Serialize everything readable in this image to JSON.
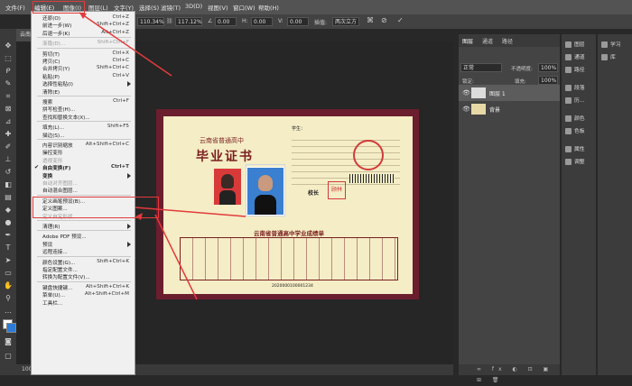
{
  "menubar": {
    "items": [
      "文件(F)",
      "编辑(E)",
      "图像(I)",
      "图层(L)",
      "文字(Y)",
      "选择(S)",
      "滤镜(T)",
      "3D(D)",
      "视图(V)",
      "窗口(W)",
      "帮助(H)"
    ]
  },
  "optionsbar": {
    "x_value": "110.34%",
    "y_value": "117.12%",
    "angle_value": "0.00",
    "h_value": "0.00",
    "v_value": "0.00",
    "interp": "两次立方",
    "angle_label": "∠",
    "h_label": "H:",
    "v_label": "V:",
    "interp_label": "插值:"
  },
  "doc_tab": "云南省",
  "status": "100%",
  "edit_menu": {
    "items": [
      {
        "label": "还原(O)",
        "shortcut": "Ctrl+Z",
        "disabled": false
      },
      {
        "label": "前进一步(W)",
        "shortcut": "Shift+Ctrl+Z",
        "disabled": false
      },
      {
        "label": "后退一步(K)",
        "shortcut": "Alt+Ctrl+Z",
        "disabled": false
      },
      {
        "sep": true
      },
      {
        "label": "渐隐(D)...",
        "shortcut": "Shift+Ctrl+F",
        "disabled": true
      },
      {
        "sep": true
      },
      {
        "label": "剪切(T)",
        "shortcut": "Ctrl+X",
        "disabled": false
      },
      {
        "label": "拷贝(C)",
        "shortcut": "Ctrl+C",
        "disabled": false
      },
      {
        "label": "合并拷贝(Y)",
        "shortcut": "Shift+Ctrl+C",
        "disabled": false
      },
      {
        "label": "粘贴(P)",
        "shortcut": "Ctrl+V",
        "disabled": false
      },
      {
        "label": "选择性粘贴(I)",
        "shortcut": "",
        "disabled": false,
        "submenu": true
      },
      {
        "label": "清除(E)",
        "shortcut": "",
        "disabled": false
      },
      {
        "sep": true
      },
      {
        "label": "搜索",
        "shortcut": "Ctrl+F",
        "disabled": false
      },
      {
        "label": "拼写检查(H)...",
        "shortcut": "",
        "disabled": false
      },
      {
        "label": "查找和替换文本(X)...",
        "shortcut": "",
        "disabled": false
      },
      {
        "sep": true
      },
      {
        "label": "填充(L)...",
        "shortcut": "Shift+F5",
        "disabled": false
      },
      {
        "label": "描边(S)...",
        "shortcut": "",
        "disabled": false
      },
      {
        "sep": true
      },
      {
        "label": "内容识别缩放",
        "shortcut": "Alt+Shift+Ctrl+C",
        "disabled": false
      },
      {
        "label": "操控变形",
        "shortcut": "",
        "disabled": false
      },
      {
        "label": "透视变形",
        "shortcut": "",
        "disabled": true
      },
      {
        "label": "自由变换(F)",
        "shortcut": "Ctrl+T",
        "disabled": false,
        "checked": true,
        "bold": true
      },
      {
        "label": "变换",
        "shortcut": "",
        "disabled": false,
        "submenu": true,
        "bold": true
      },
      {
        "label": "自动对齐图层...",
        "shortcut": "",
        "disabled": true
      },
      {
        "label": "自动混合图层...",
        "shortcut": "",
        "disabled": false
      },
      {
        "sep": true
      },
      {
        "label": "定义画笔预设(B)...",
        "shortcut": "",
        "disabled": false
      },
      {
        "label": "定义图案...",
        "shortcut": "",
        "disabled": false
      },
      {
        "label": "定义自定形状...",
        "shortcut": "",
        "disabled": true
      },
      {
        "sep": true
      },
      {
        "label": "清理(R)",
        "shortcut": "",
        "disabled": false,
        "submenu": true
      },
      {
        "sep": true
      },
      {
        "label": "Adobe PDF 预设...",
        "shortcut": "",
        "disabled": false
      },
      {
        "label": "预设",
        "shortcut": "",
        "disabled": false,
        "submenu": true
      },
      {
        "label": "远程连接...",
        "shortcut": "",
        "disabled": false
      },
      {
        "sep": true
      },
      {
        "label": "颜色设置(G)...",
        "shortcut": "Shift+Ctrl+K",
        "disabled": false
      },
      {
        "label": "指定配置文件...",
        "shortcut": "",
        "disabled": false
      },
      {
        "label": "转换为配置文件(V)...",
        "shortcut": "",
        "disabled": false
      },
      {
        "sep": true
      },
      {
        "label": "键盘快捷键...",
        "shortcut": "Alt+Shift+Ctrl+K",
        "disabled": false
      },
      {
        "label": "菜单(U)...",
        "shortcut": "Alt+Shift+Ctrl+M",
        "disabled": false
      },
      {
        "label": "工具栏...",
        "shortcut": "",
        "disabled": false
      }
    ]
  },
  "layers_panel": {
    "tabs": [
      "图层",
      "通道",
      "路径"
    ],
    "blend_mode": "正常",
    "opacity_label": "不透明度:",
    "opacity_value": "100%",
    "lock_label": "锁定:",
    "fill_label": "填充:",
    "fill_value": "100%",
    "layers": [
      {
        "name": "图层 1",
        "selected": true
      },
      {
        "name": "背景",
        "selected": false
      }
    ]
  },
  "right_strip": {
    "items": [
      "图层",
      "通道",
      "路径",
      "段落",
      "历...",
      "颜色",
      "色板",
      "属性",
      "调整"
    ]
  },
  "far_right": {
    "items": [
      "学习",
      "库"
    ]
  },
  "certificate": {
    "province": "云南省普通高中",
    "title": "毕业证书",
    "student_label": "学生：",
    "school_label": "校长",
    "table_title": "云南省普通高中学业成绩单",
    "seal": "顾林",
    "serial": "2020000100001234"
  }
}
